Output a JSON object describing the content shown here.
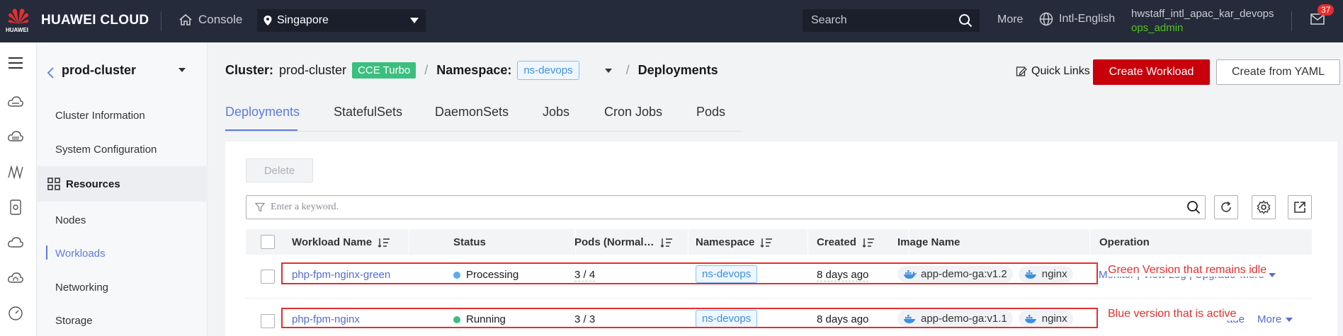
{
  "topbar": {
    "logo_text": "HUAWEI",
    "brand": "HUAWEI CLOUD",
    "console": "Console",
    "region": "Singapore",
    "search_placeholder": "Search",
    "more": "More",
    "language": "Intl-English",
    "username": "hwstaff_intl_apac_kar_devops",
    "role": "ops_admin",
    "notification_count": "37"
  },
  "sidebar": {
    "cluster_name": "prod-cluster",
    "items": {
      "cluster_info": "Cluster Information",
      "system_config": "System Configuration",
      "resources": "Resources",
      "nodes": "Nodes",
      "workloads": "Workloads",
      "networking": "Networking",
      "storage": "Storage"
    }
  },
  "breadcrumb": {
    "cluster_label": "Cluster:",
    "cluster_value": "prod-cluster",
    "cluster_tag": "CCE Turbo",
    "namespace_label": "Namespace:",
    "namespace_value": "ns-devops",
    "page": "Deployments"
  },
  "header_actions": {
    "quick_links": "Quick Links",
    "create_workload": "Create Workload",
    "create_yaml": "Create from YAML"
  },
  "tabs": [
    "Deployments",
    "StatefulSets",
    "DaemonSets",
    "Jobs",
    "Cron Jobs",
    "Pods"
  ],
  "toolbar": {
    "delete": "Delete",
    "filter_placeholder": "Enter a keyword."
  },
  "table": {
    "columns": {
      "name": "Workload Name",
      "status": "Status",
      "pods": "Pods (Normal…",
      "namespace": "Namespace",
      "created": "Created",
      "image": "Image Name",
      "operation": "Operation"
    },
    "rows": [
      {
        "name": "php-fpm-nginx-green",
        "status": "Processing",
        "status_color": "#5ea9f3",
        "pods": "3 / 4",
        "namespace": "ns-devops",
        "created": "8 days ago",
        "image1": "app-demo-ga:v1.2",
        "image2": "nginx",
        "op_visible": "Monitor | View Log | Upgrade",
        "op_more": "More",
        "annotation": "Green Version that remains idle"
      },
      {
        "name": "php-fpm-nginx",
        "status": "Running",
        "status_color": "#3bbf7f",
        "pods": "3 / 3",
        "namespace": "ns-devops",
        "created": "8 days ago",
        "image1": "app-demo-ga:v1.1",
        "image2": "nginx",
        "op_visible": "ade",
        "op_more": "More",
        "annotation": "Blue version that is active"
      }
    ]
  },
  "colors": {
    "topbar_bg": "#252b3a",
    "accent_red": "#c7000b",
    "link_blue": "#526ecc",
    "tab_active": "#5e7ce0",
    "annotation_red": "#e32f2f"
  }
}
